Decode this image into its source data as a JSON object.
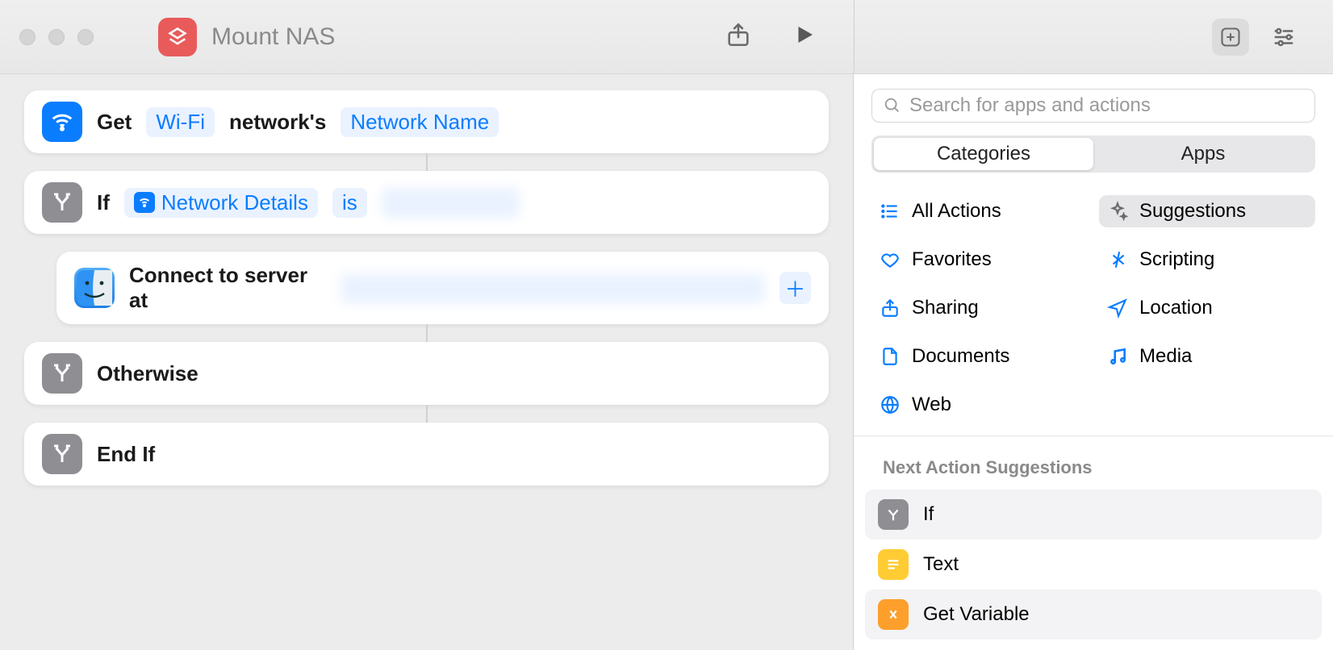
{
  "title": "Mount NAS",
  "search": {
    "placeholder": "Search for apps and actions"
  },
  "segments": {
    "categories": "Categories",
    "apps": "Apps"
  },
  "categories": {
    "all": "All Actions",
    "suggestions": "Suggestions",
    "favorites": "Favorites",
    "scripting": "Scripting",
    "sharing": "Sharing",
    "location": "Location",
    "documents": "Documents",
    "media": "Media",
    "web": "Web"
  },
  "next_header": "Next Action Suggestions",
  "suggestions": [
    {
      "label": "If"
    },
    {
      "label": "Text"
    },
    {
      "label": "Get Variable"
    }
  ],
  "actions": {
    "get": {
      "verb": "Get",
      "source": "Wi-Fi",
      "connector": "network's",
      "property": "Network Name"
    },
    "if": {
      "verb": "If",
      "var": "Network Details",
      "op": "is",
      "value": "████████"
    },
    "connect": {
      "verb": "Connect to server at",
      "value": "████████████████████████████"
    },
    "otherwise": "Otherwise",
    "endif": "End If"
  }
}
